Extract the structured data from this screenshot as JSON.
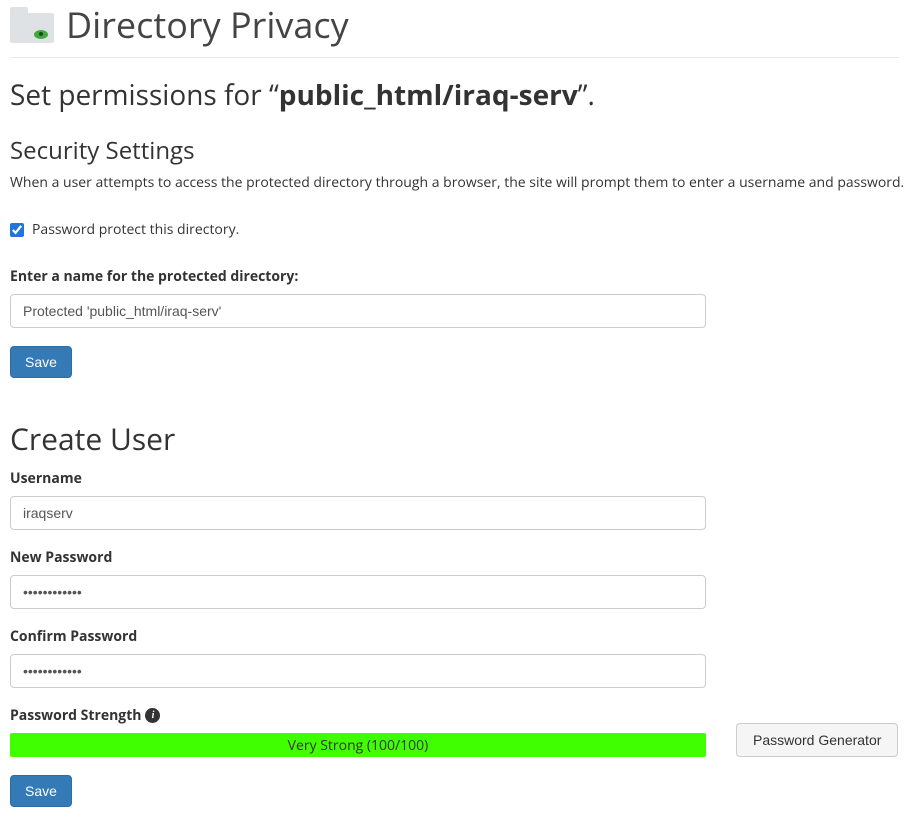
{
  "header": {
    "title": "Directory Privacy"
  },
  "permissions": {
    "prefix": "Set permissions for “",
    "path": "public_html/iraq-serv",
    "suffix": "”."
  },
  "security": {
    "heading": "Security Settings",
    "description": "When a user attempts to access the protected directory through a browser, the site will prompt them to enter a username and password. ",
    "checkbox_label": "Password protect this directory.",
    "checkbox_checked": true,
    "name_label": "Enter a name for the protected directory:",
    "name_value": "Protected 'public_html/iraq-serv'",
    "save_label": "Save"
  },
  "create_user": {
    "heading": "Create User",
    "username_label": "Username",
    "username_value": "iraqserv",
    "new_password_label": "New Password",
    "new_password_value": "••••••••••••",
    "confirm_password_label": "Confirm Password",
    "confirm_password_value": "••••••••••••",
    "strength_label": "Password Strength",
    "strength_text": "Very Strong (100/100)",
    "strength_color": "#40ff00",
    "generator_label": "Password Generator",
    "save_label": "Save"
  }
}
